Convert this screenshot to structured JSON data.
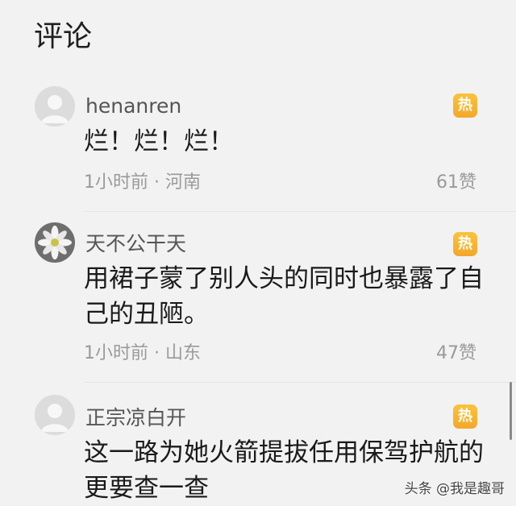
{
  "page": {
    "title": "评论"
  },
  "comments": [
    {
      "username": "henanren",
      "hot_label": "热",
      "content": "烂！烂！烂！",
      "time": "1小时前",
      "location": "河南",
      "likes": "61赞",
      "avatar_icon": "default-user-avatar-icon"
    },
    {
      "username": "天不公干天",
      "hot_label": "热",
      "content": "用裙子蒙了别人头的同时也暴露了自己的丑陋。",
      "time": "1小时前",
      "location": "山东",
      "likes": "47赞",
      "avatar_icon": "white-flower-avatar-icon"
    },
    {
      "username": "正宗凉白开",
      "hot_label": "热",
      "content": "这一路为她火箭提拔任用保驾护航的更要查一查",
      "avatar_icon": "default-user-avatar-icon"
    }
  ],
  "watermark": {
    "text": "头条 @我是趣哥"
  },
  "colors": {
    "background": "#f2f2f2",
    "hot_badge": "#f6b132",
    "meta_text": "#9a9a9a"
  }
}
